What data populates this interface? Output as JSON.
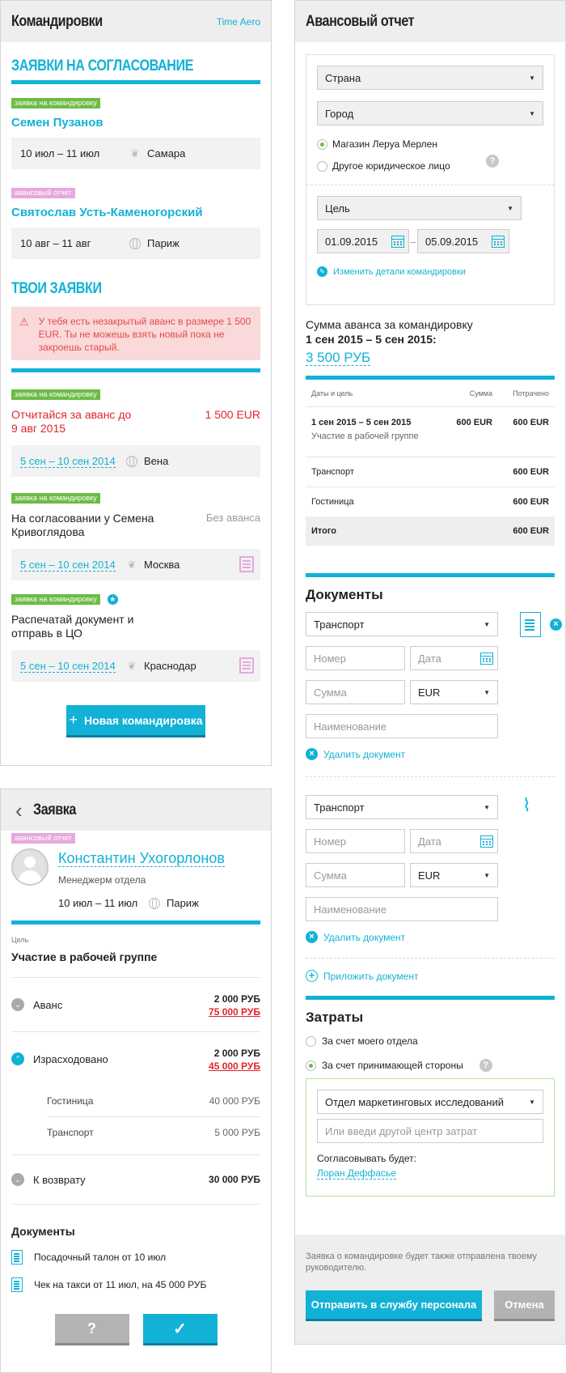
{
  "trips": {
    "title": "Командировки",
    "brand": "Time Aero",
    "approval_title": "ЗАЯВКИ НА СОГЛАСОВАНИЕ",
    "approval": [
      {
        "tag": "заявка на командировку",
        "name": "Семен Пузанов",
        "dates": "10 июл – 11 июл",
        "city": "Самара"
      },
      {
        "tag": "авансовый отчет",
        "name": "Святослав Усть-Каменогорский",
        "dates": "10 авг – 11 авг",
        "city": "Париж"
      }
    ],
    "my_title": "ТВОИ ЗАЯВКИ",
    "alert": "У тебя есть незакрытый аванс в размере 1 500 EUR. Ты не можешь взять новый пока не закроешь старый.",
    "my": [
      {
        "tag": "заявка на командировку",
        "status": "Отчитайся за аванс до 9 авг 2015",
        "amount": "1 500 EUR",
        "dates": "5 сен – 10 сен 2014",
        "city": "Вена"
      },
      {
        "tag": "заявка на командировку",
        "status": "На согласовании у Семена Кривоглядова",
        "amount": "Без аванса",
        "dates": "5 сен – 10 сен 2014",
        "city": "Москва"
      },
      {
        "tag": "заявка на командировку",
        "status": "Распечатай документ и отправь в ЦО",
        "amount": "",
        "dates": "5 сен – 10 сен 2014",
        "city": "Краснодар"
      }
    ],
    "new_button": "Новая командировка"
  },
  "request": {
    "title": "Заявка",
    "tag": "авансовый отчет",
    "name": "Константин Ухогорлонов",
    "position": "Менеджерм отдела",
    "dates": "10 июл – 11 июл",
    "city": "Париж",
    "goal_label": "Цель",
    "goal": "Участие в рабочей группе",
    "advance_label": "Аванс",
    "advance_a": "2 000 РУБ",
    "advance_b": "75 000 РУБ",
    "spent_label": "Израсходовано",
    "spent_a": "2 000 РУБ",
    "spent_b": "45 000 РУБ",
    "sub": [
      {
        "label": "Гостиница",
        "value": "40 000 РУБ"
      },
      {
        "label": "Транспорт",
        "value": "5 000 РУБ"
      }
    ],
    "refund_label": "К возврату",
    "refund": "30 000 РУБ",
    "docs_title": "Документы",
    "docs": [
      "Посадочный талон от 10 июл",
      "Чек на такси от 11 июл, на 45 000 РУБ"
    ],
    "help_btn": "?",
    "ok_btn": "✓"
  },
  "report": {
    "title": "Авансовый отчет",
    "country": "Страна",
    "city": "Город",
    "radio1": "Магазин Леруа Мерлен",
    "radio2": "Другое юридическое лицо",
    "goal": "Цель",
    "date_from": "01.09.2015",
    "date_to": "05.09.2015",
    "edit_link": "Изменить детали командировки",
    "sum_label": "Сумма аванса за командировку",
    "sum_period": "1 сен 2015 – 5 сен 2015:",
    "sum_value": "3 500 РУБ",
    "table_head": [
      "Даты и цель",
      "Сумма",
      "Потрачено"
    ],
    "table_first": {
      "dates": "1 сен 2015 – 5 сен 2015",
      "goal": "Участие в рабочей группе",
      "sum": "600 EUR",
      "spent": "600 EUR"
    },
    "table_rows": [
      {
        "label": "Транспорт",
        "spent": "600 EUR"
      },
      {
        "label": "Гостиница",
        "spent": "600 EUR"
      }
    ],
    "total_label": "Итого",
    "total": "600 EUR",
    "docs_title": "Документы",
    "doc_type": "Транспорт",
    "number_ph": "Номер",
    "date_ph": "Дата",
    "sum_ph": "Сумма",
    "currency": "EUR",
    "name_ph": "Наименование",
    "delete_doc": "Удалить документ",
    "attach_doc": "Приложить документ",
    "costs_title": "Затраты",
    "cost1": "За счет моего отдела",
    "cost2": "За счет принимающей стороны",
    "dept": "Отдел маркетинговых исследований",
    "center_ph": "Или введи другой центр затрат",
    "approver_label": "Согласовывать будет:",
    "approver": "Лоран Деффасье",
    "note": "Заявка о командировке будет также отправлена твоему руководителю.",
    "send_btn": "Отправить в службу персонала",
    "cancel_btn": "Отмена"
  }
}
